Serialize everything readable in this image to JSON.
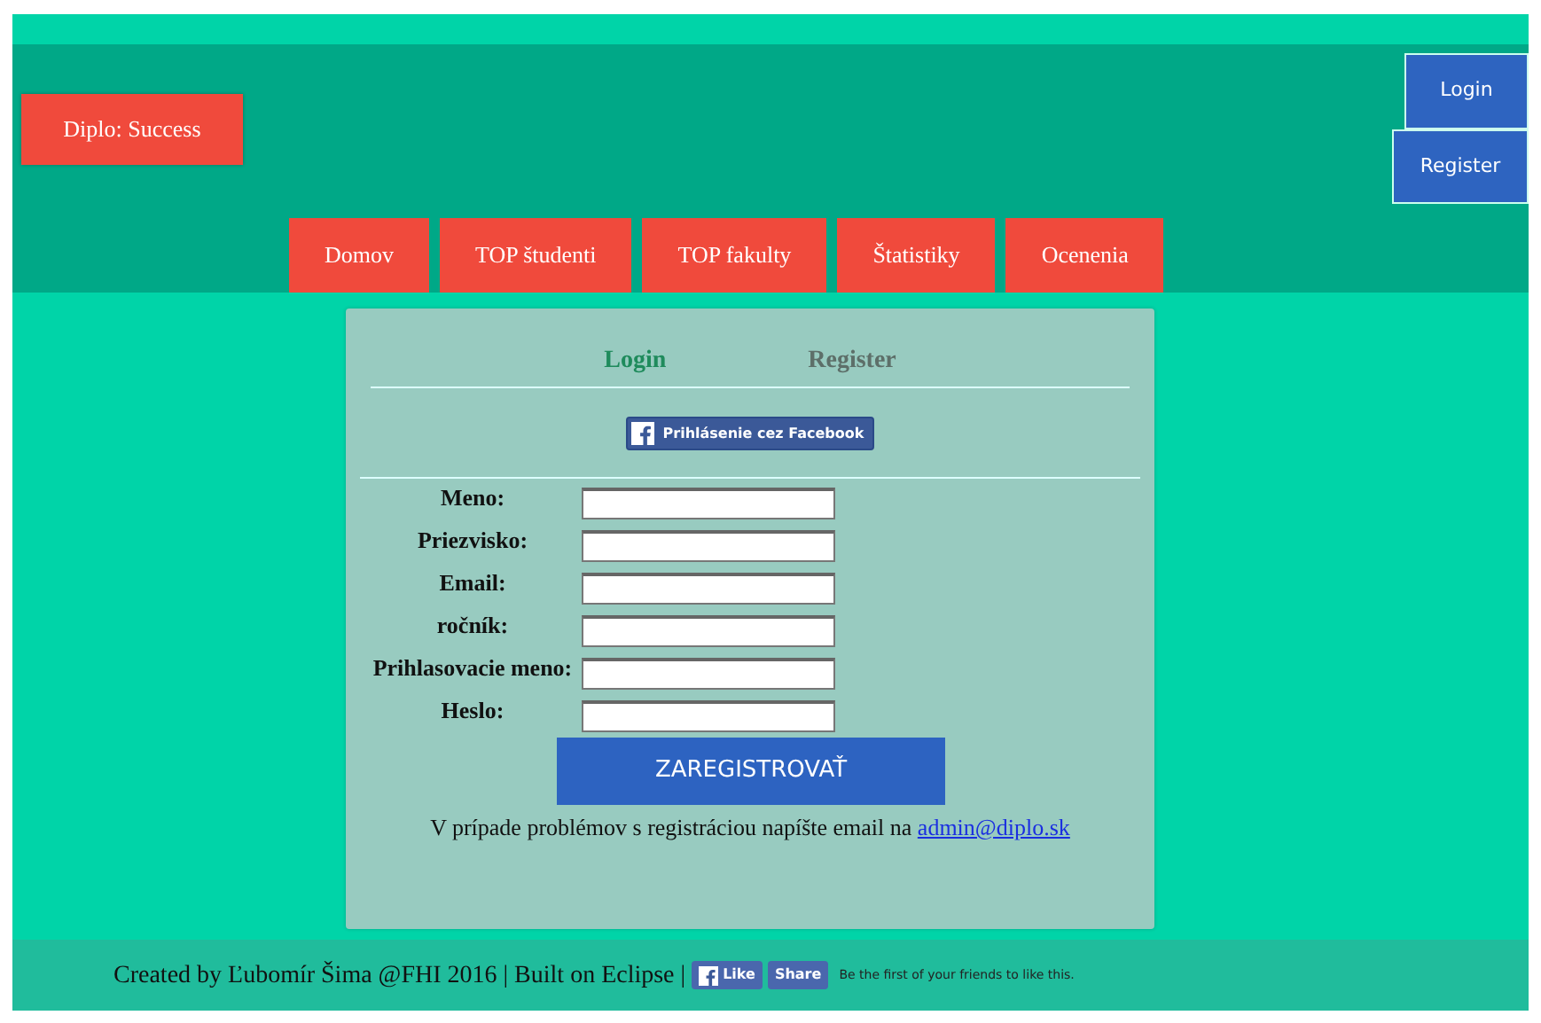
{
  "brand": "Diplo: Success",
  "auth_buttons": [
    {
      "label": "Login"
    },
    {
      "label": "Register"
    }
  ],
  "nav": [
    {
      "label": "Domov"
    },
    {
      "label": "TOP študenti"
    },
    {
      "label": "TOP fakulty"
    },
    {
      "label": "Štatistiky"
    },
    {
      "label": "Ocenenia"
    }
  ],
  "auth_tabs": [
    {
      "label": "Login",
      "selected": true
    },
    {
      "label": "Register",
      "selected": false
    }
  ],
  "facebook_button": "Prihlásenie cez Facebook",
  "fields": [
    {
      "label": "Meno:"
    },
    {
      "label": "Priezvisko:"
    },
    {
      "label": "Email:"
    },
    {
      "label": "ročník:"
    },
    {
      "label": "Prihlasovacie meno:"
    },
    {
      "label": "Heslo:"
    }
  ],
  "submit": "ZAREGISTROVAŤ",
  "help": {
    "text": "V prípade problémov s registráciou napíšte email na",
    "link": "admin@diplo.sk"
  },
  "footer": {
    "text": "Created by Ľubomír Šima @FHI 2016 | Built on Eclipse |",
    "like": "Like",
    "share": "Share",
    "social_text": "Be the first of your friends to like this."
  }
}
